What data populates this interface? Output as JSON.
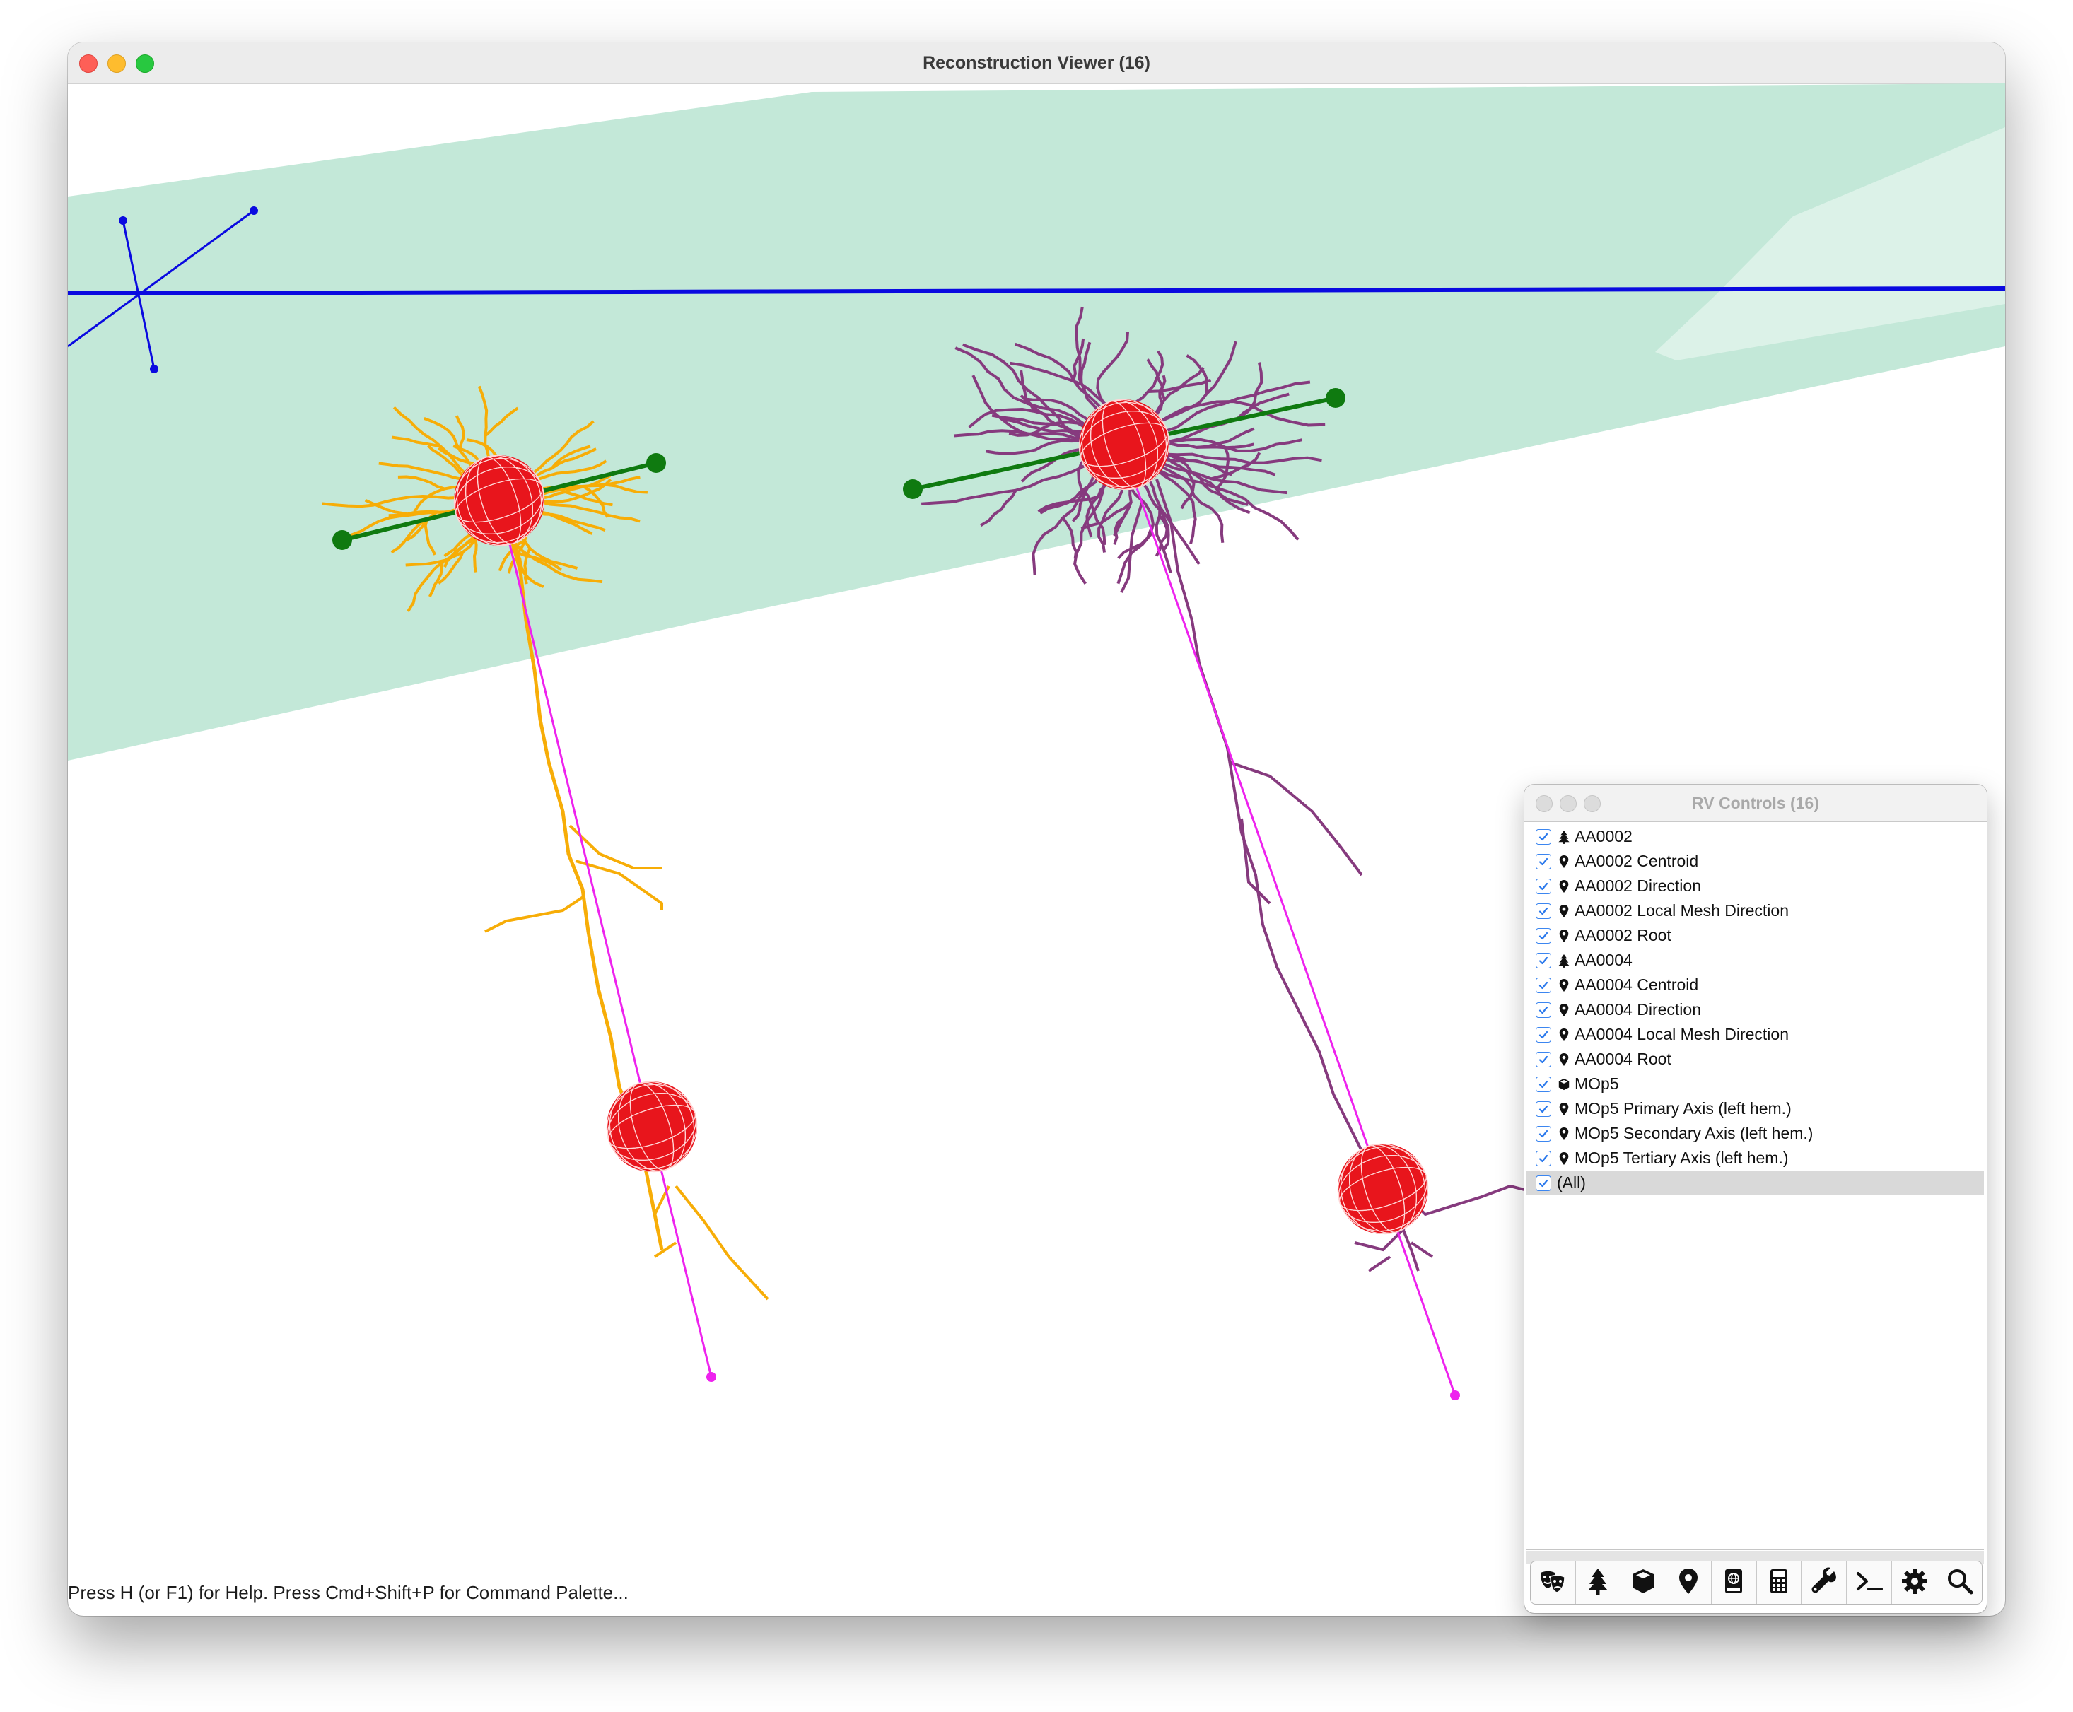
{
  "window": {
    "title": "Reconstruction Viewer (16)",
    "status": "Press H (or F1) for Help. Press Cmd+Shift+P for Command Palette..."
  },
  "viewer": {
    "mesh_color": "#c3e8d8",
    "mesh_highlight_color": "#dcf2e8",
    "axis_color": "#0a0ae0",
    "direction_color": "#0f7a10",
    "root_line_color": "#ee22ee",
    "soma_color": "#e8151c",
    "neuron_1_color": "#f7ad07",
    "neuron_2_color": "#863a7e"
  },
  "controls": {
    "title": "RV Controls (16)",
    "items": [
      {
        "label": "AA0002",
        "icon": "tree-icon",
        "checked": true
      },
      {
        "label": "AA0002 Centroid",
        "icon": "marker-icon",
        "checked": true
      },
      {
        "label": "AA0002 Direction",
        "icon": "marker-icon",
        "checked": true
      },
      {
        "label": "AA0002 Local Mesh Direction",
        "icon": "marker-icon",
        "checked": true
      },
      {
        "label": "AA0002 Root",
        "icon": "marker-icon",
        "checked": true
      },
      {
        "label": "AA0004",
        "icon": "tree-icon",
        "checked": true
      },
      {
        "label": "AA0004 Centroid",
        "icon": "marker-icon",
        "checked": true
      },
      {
        "label": "AA0004 Direction",
        "icon": "marker-icon",
        "checked": true
      },
      {
        "label": "AA0004 Local Mesh Direction",
        "icon": "marker-icon",
        "checked": true
      },
      {
        "label": "AA0004 Root",
        "icon": "marker-icon",
        "checked": true
      },
      {
        "label": "MOp5",
        "icon": "cube-icon",
        "checked": true
      },
      {
        "label": "MOp5 Primary Axis (left hem.)",
        "icon": "marker-icon",
        "checked": true
      },
      {
        "label": "MOp5 Secondary Axis (left hem.)",
        "icon": "marker-icon",
        "checked": true
      },
      {
        "label": "MOp5 Tertiary Axis (left hem.)",
        "icon": "marker-icon",
        "checked": true
      },
      {
        "label": "(All)",
        "icon": "",
        "checked": true,
        "selected": true
      }
    ],
    "toolbar": [
      "masks-icon",
      "tree-icon",
      "cube-icon",
      "marker-icon",
      "atlas-icon",
      "calculator-icon",
      "wrench-icon",
      "terminal-icon",
      "gear-icon",
      "search-icon"
    ]
  }
}
